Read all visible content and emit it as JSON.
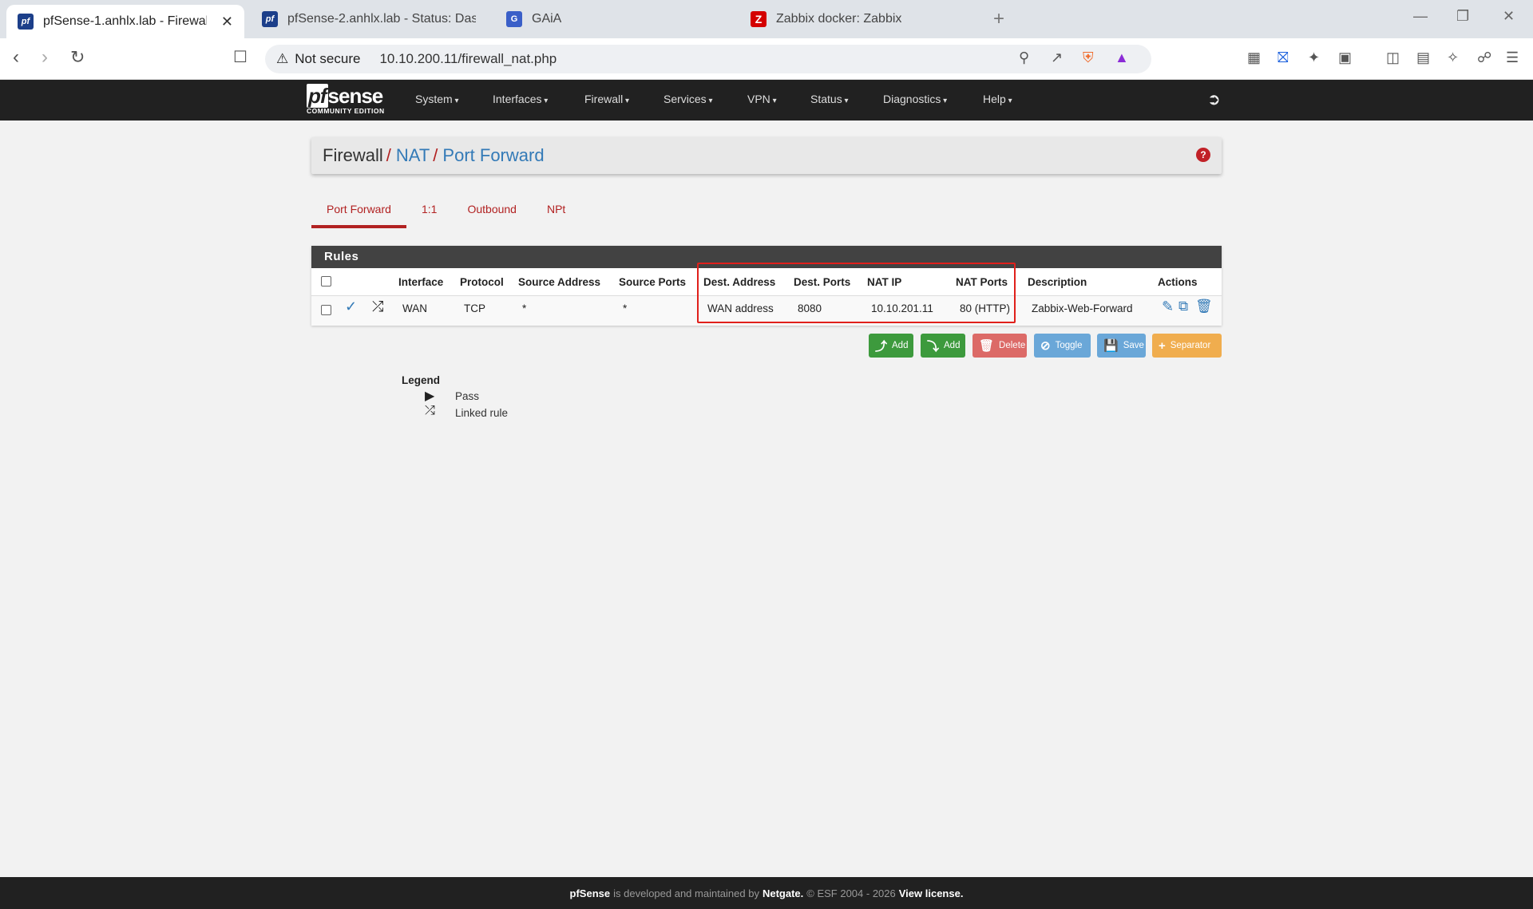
{
  "browser": {
    "tabs": [
      {
        "title": "pfSense-1.anhlx.lab - Firewall: N/",
        "icon": "pfsense-icon",
        "fav": "pf"
      },
      {
        "title": "pfSense-2.anhlx.lab - Status: Dashbo",
        "icon": "pfsense-icon",
        "fav": "pf"
      },
      {
        "title": "GAiA",
        "icon": "gaia-icon",
        "fav": "G"
      },
      {
        "title": "Zabbix docker: Zabbix",
        "icon": "zabbix-icon",
        "fav": "Z"
      }
    ],
    "address": {
      "security": "Not secure",
      "url": "10.10.200.11/firewall_nat.php"
    }
  },
  "nav": {
    "logo_main": "sense",
    "logo_pf": "pf",
    "logo_sub": "COMMUNITY EDITION",
    "menus": [
      "System",
      "Interfaces",
      "Firewall",
      "Services",
      "VPN",
      "Status",
      "Diagnostics",
      "Help"
    ]
  },
  "breadcrumb": {
    "root": "Firewall",
    "nat": "NAT",
    "current": "Port Forward",
    "sep": "/",
    "help": "?"
  },
  "tabs": [
    "Port Forward",
    "1:1",
    "Outbound",
    "NPt"
  ],
  "rules": {
    "title": "Rules",
    "columns": [
      "Interface",
      "Protocol",
      "Source Address",
      "Source Ports",
      "Dest. Address",
      "Dest. Ports",
      "NAT IP",
      "NAT Ports",
      "Description",
      "Actions"
    ],
    "rows": [
      {
        "interface": "WAN",
        "protocol": "TCP",
        "source_address": "*",
        "source_ports": "*",
        "dest_address": "WAN address",
        "dest_ports": "8080",
        "nat_ip": "10.10.201.11",
        "nat_ports": "80 (HTTP)",
        "description": "Zabbix-Web-Forward"
      }
    ]
  },
  "buttons": {
    "add_top": "Add",
    "add_bottom": "Add",
    "delete": "Delete",
    "toggle": "Toggle",
    "save": "Save",
    "separator": "Separator"
  },
  "legend": {
    "title": "Legend",
    "items": [
      "Pass",
      "Linked rule"
    ]
  },
  "footer": {
    "brand": "pfSense",
    "text1": "is developed and maintained by",
    "company": "Netgate.",
    "text2": "© ESF 2004 - 2026",
    "license": "View license."
  },
  "colors": {
    "navbar": "#212121",
    "accent_red": "#b22222",
    "link_blue": "#337ab7",
    "highlight": "#e0201b"
  }
}
